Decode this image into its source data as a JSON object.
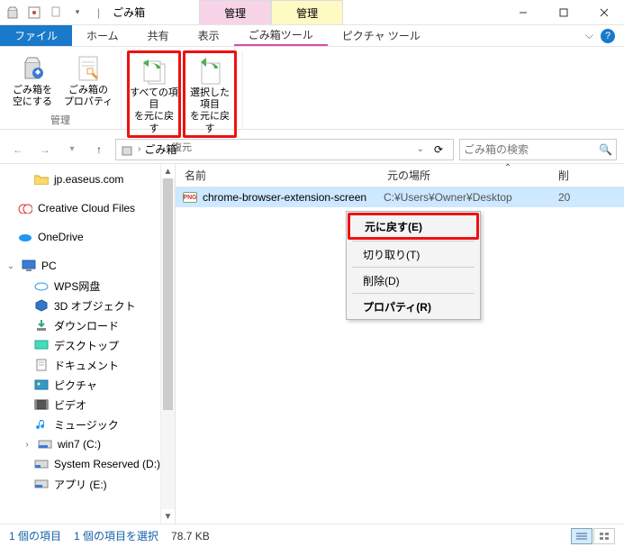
{
  "title": "ごみ箱",
  "context_tabs": {
    "pink": "管理",
    "yellow": "管理"
  },
  "tabs": {
    "file": "ファイル",
    "home": "ホーム",
    "share": "共有",
    "view": "表示",
    "recycle_tools": "ごみ箱ツール",
    "picture_tools": "ピクチャ ツール"
  },
  "ribbon": {
    "manage_group": "管理",
    "restore_group": "復元",
    "empty": "ごみ箱を\n空にする",
    "properties": "ごみ箱の\nプロパティ",
    "restore_all": "すべての項目\nを元に戻す",
    "restore_selected": "選択した項目\nを元に戻す"
  },
  "nav": {
    "breadcrumb": "ごみ箱",
    "search_placeholder": "ごみ箱の検索"
  },
  "tree": {
    "easeus": "jp.easeus.com",
    "ccf": "Creative Cloud Files",
    "onedrive": "OneDrive",
    "pc": "PC",
    "wps": "WPS网盘",
    "obj3d": "3D オブジェクト",
    "downloads": "ダウンロード",
    "desktop": "デスクトップ",
    "documents": "ドキュメント",
    "pictures": "ピクチャ",
    "videos": "ビデオ",
    "music": "ミュージック",
    "win7": "win7 (C:)",
    "sysres": "System Reserved (D:)",
    "apps": "アプリ (E:)"
  },
  "columns": {
    "name": "名前",
    "location": "元の場所",
    "date": "削"
  },
  "file": {
    "name": "chrome-browser-extension-screen",
    "location": "C:¥Users¥Owner¥Desktop",
    "date": "20"
  },
  "context_menu": {
    "restore": "元に戻す(E)",
    "cut": "切り取り(T)",
    "delete": "削除(D)",
    "properties": "プロパティ(R)"
  },
  "status": {
    "count": "1 個の項目",
    "selected": "1 個の項目を選択",
    "size": "78.7 KB"
  }
}
